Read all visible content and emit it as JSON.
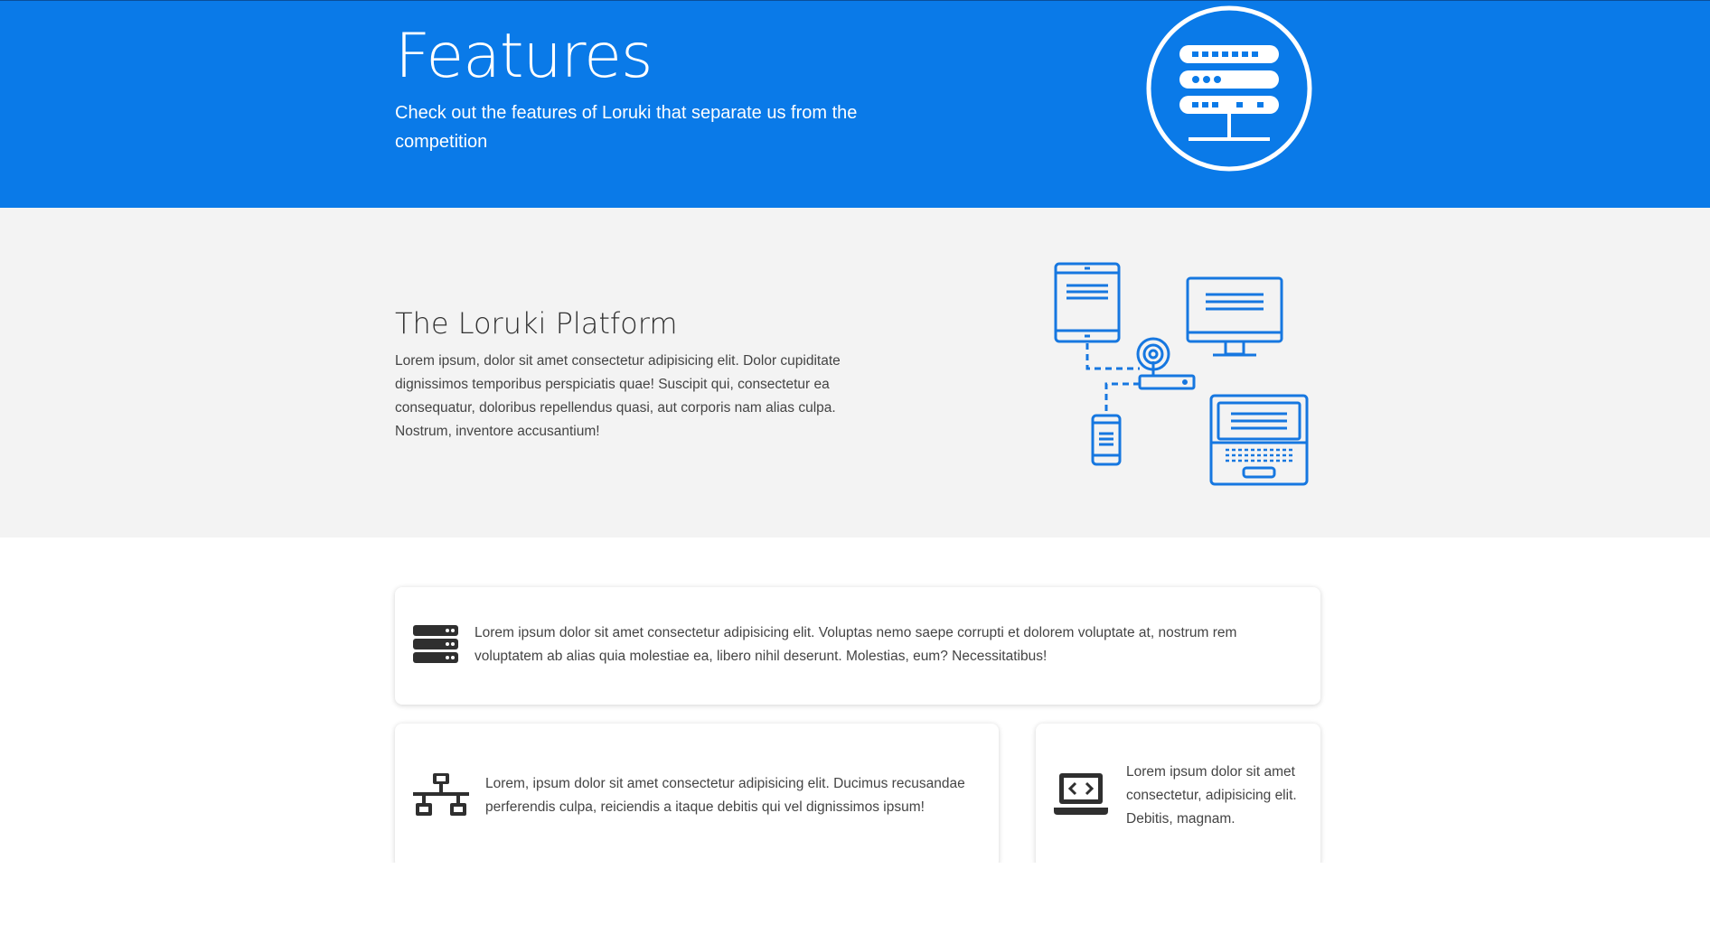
{
  "hero": {
    "title": "Features",
    "subtitle": "Check out the features of Loruki that separate us from the competition",
    "icon": "server-circle-icon",
    "background_color": "#0a7ae8"
  },
  "platform": {
    "title": "The Loruki Platform",
    "text": "Lorem ipsum, dolor sit amet consectetur adipisicing elit. Dolor cupiditate dignissimos temporibus perspiciatis quae! Suscipit qui, consectetur ea consequatur, doloribus repellendus quasi, aut corporis nam alias culpa. Nostrum, inventore accusantium!",
    "illustration": "connected-devices-icon",
    "background_color": "#f3f3f3"
  },
  "cards": [
    {
      "icon": "server-icon",
      "text": "Lorem ipsum dolor sit amet consectetur adipisicing elit. Voluptas nemo saepe corrupti et dolorem voluptate at, nostrum rem voluptatem ab alias quia molestiae ea, libero nihil deserunt. Molestias, eum? Necessitatibus!"
    },
    {
      "icon": "network-icon",
      "text": "Lorem, ipsum dolor sit amet consectetur adipisicing elit. Ducimus recusandae perferendis culpa, reiciendis a itaque debitis qui vel dignissimos ipsum!"
    },
    {
      "icon": "laptop-code-icon",
      "text": "Lorem ipsum dolor sit amet consectetur, adipisicing elit. Debitis, magnam."
    }
  ],
  "colors": {
    "accent": "#0a7ae8",
    "illustration_blue": "#1677e0",
    "icon_dark": "#2f2f2f"
  }
}
